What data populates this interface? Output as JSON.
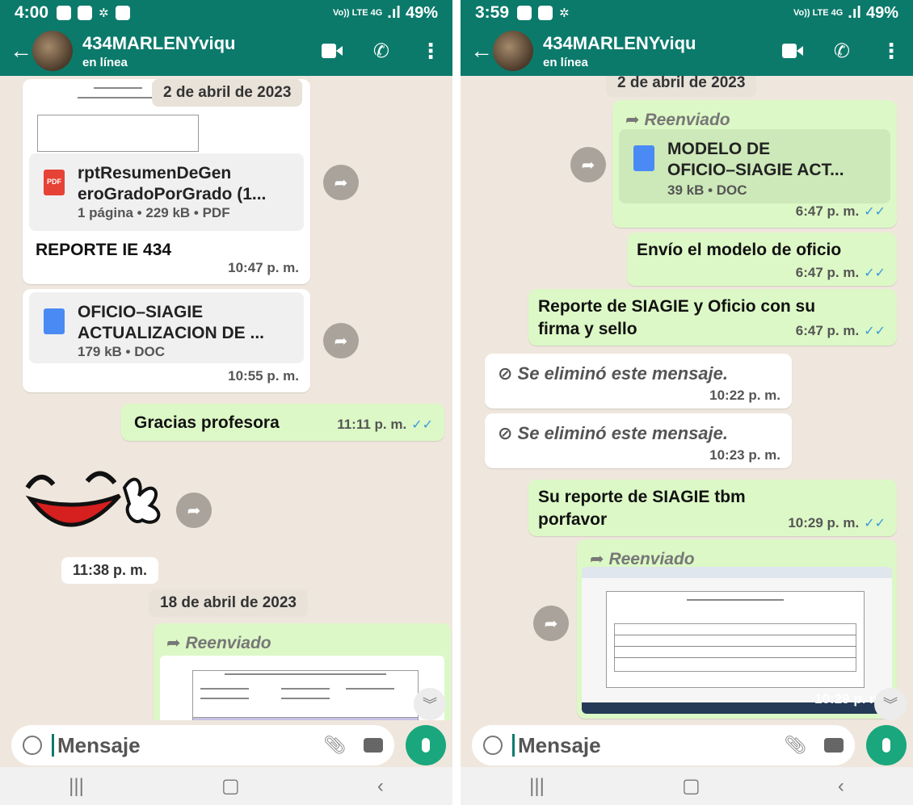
{
  "left": {
    "status": {
      "time": "4:00",
      "signal": "Vo)) LTE 4G",
      "battery": "49%"
    },
    "header": {
      "name": "434MARLENYviqu",
      "presence": "en línea"
    },
    "messages": {
      "date1": "2 de abril de 2023",
      "pdf": {
        "title_line1": "rptResumenDeGen",
        "title_line2": "eroGradoPorGrado (1...",
        "meta": "1 página • 229 kB • PDF",
        "icon_label": "PDF",
        "caption": "REPORTE IE 434",
        "time": "10:47 p. m."
      },
      "doc1": {
        "title_line1": "OFICIO–SIAGIE",
        "title_line2": "ACTUALIZACION DE ...",
        "meta": "179 kB • DOC",
        "time": "10:55 p. m."
      },
      "out1": {
        "text": "Gracias profesora",
        "time": "11:11 p. m."
      },
      "sticker_time": "11:38 p. m.",
      "date2": "18 de abril de 2023",
      "fwd": {
        "label": "Reenviado"
      }
    },
    "input": {
      "placeholder": "Mensaje"
    }
  },
  "right": {
    "status": {
      "time": "3:59",
      "signal": "Vo)) LTE 4G",
      "battery": "49%"
    },
    "header": {
      "name": "434MARLENYviqu",
      "presence": "en línea"
    },
    "messages": {
      "date_top": "2 de abril de 2023",
      "fwd_doc": {
        "label": "Reenviado",
        "title_line1": "MODELO DE",
        "title_line2": "OFICIO–SIAGIE ACT...",
        "meta": "39 kB • DOC",
        "time": "6:47 p. m."
      },
      "out2": {
        "text": "Envío el modelo de oficio",
        "time": "6:47 p. m."
      },
      "out3": {
        "line1": "Reporte de SIAGIE y Oficio con su",
        "line2": "firma y sello",
        "time": "6:47 p. m."
      },
      "del1": {
        "text": "Se eliminó este mensaje.",
        "time": "10:22 p. m."
      },
      "del2": {
        "text": "Se eliminó este mensaje.",
        "time": "10:23 p. m."
      },
      "out4": {
        "line1": "Su reporte de SIAGIE tbm",
        "line2": "porfavor",
        "time": "10:29 p. m."
      },
      "fwd_img": {
        "label": "Reenviado",
        "time": "10:29 p. m."
      }
    },
    "input": {
      "placeholder": "Mensaje"
    }
  },
  "colors": {
    "header": "#0b7a6b",
    "outgoing": "#dcf8c6",
    "incoming": "#ffffff",
    "tick": "#3a9ad9",
    "mic": "#1aa77d"
  },
  "icons": [
    "back-arrow-icon",
    "video-call-icon",
    "phone-icon",
    "more-icon",
    "forward-icon",
    "document-icon",
    "pdf-icon",
    "deleted-icon",
    "emoji-icon",
    "attach-icon",
    "camera-icon",
    "mic-icon",
    "scroll-down-icon"
  ]
}
